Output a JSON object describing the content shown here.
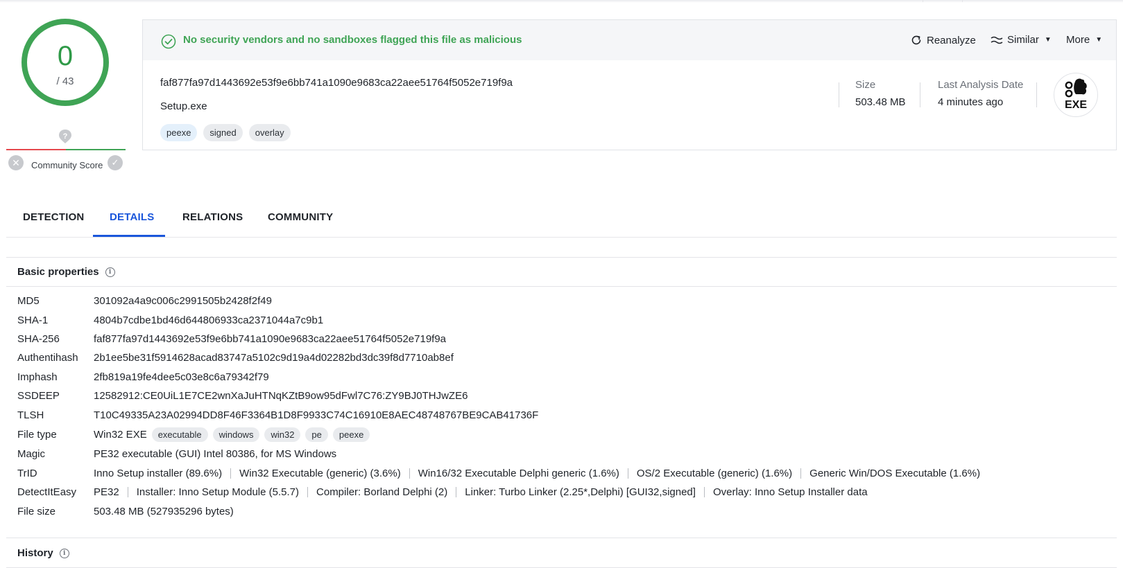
{
  "score": {
    "detections": "0",
    "total": "/ 43",
    "community_label": "Community Score"
  },
  "banner": {
    "message": "No security vendors and no sandboxes flagged this file as malicious"
  },
  "actions": {
    "reanalyze": "Reanalyze",
    "similar": "Similar",
    "more": "More"
  },
  "file": {
    "hash": "faf877fa97d1443692e53f9e6bb741a1090e9683ca22aee51764f5052e719f9a",
    "name": "Setup.exe",
    "tags": [
      "peexe",
      "signed",
      "overlay"
    ],
    "size_label": "Size",
    "size_value": "503.48 MB",
    "last_analysis_label": "Last Analysis Date",
    "last_analysis_value": "4 minutes ago",
    "type_badge": "EXE"
  },
  "tabs": [
    "DETECTION",
    "DETAILS",
    "RELATIONS",
    "COMMUNITY"
  ],
  "active_tab": "DETAILS",
  "basic_properties": {
    "title": "Basic properties",
    "rows": [
      {
        "key": "MD5",
        "value": "301092a4a9c006c2991505b2428f2f49"
      },
      {
        "key": "SHA-1",
        "value": "4804b7cdbe1bd46d644806933ca2371044a7c9b1"
      },
      {
        "key": "SHA-256",
        "value": "faf877fa97d1443692e53f9e6bb741a1090e9683ca22aee51764f5052e719f9a"
      },
      {
        "key": "Authentihash",
        "value": "2b1ee5be31f5914628acad83747a5102c9d19a4d02282bd3dc39f8d7710ab8ef"
      },
      {
        "key": "Imphash",
        "value": "2fb819a19fe4dee5c03e8c6a79342f79"
      },
      {
        "key": "SSDEEP",
        "value": "12582912:CE0UiL1E7CE2wnXaJuHTNqKZtB9ow95dFwl7C76:ZY9BJ0THJwZE6"
      },
      {
        "key": "TLSH",
        "value": "T10C49335A23A02994DD8F46F3364B1D8F9933C74C16910E8AEC48748767BE9CAB41736F"
      },
      {
        "key": "File type",
        "value": "Win32 EXE",
        "chips": [
          "executable",
          "windows",
          "win32",
          "pe",
          "peexe"
        ]
      },
      {
        "key": "Magic",
        "value": "PE32 executable (GUI) Intel 80386, for MS Windows"
      },
      {
        "key": "TrID",
        "segments": [
          "Inno Setup installer (89.6%)",
          "Win32 Executable (generic) (3.6%)",
          "Win16/32 Executable Delphi generic (1.6%)",
          "OS/2 Executable (generic) (1.6%)",
          "Generic Win/DOS Executable (1.6%)"
        ]
      },
      {
        "key": "DetectItEasy",
        "segments": [
          "PE32",
          "Installer: Inno Setup Module (5.5.7)",
          "Compiler: Borland Delphi (2)",
          "Linker: Turbo Linker (2.25*,Delphi) [GUI32,signed]",
          "Overlay: Inno Setup Installer data"
        ]
      },
      {
        "key": "File size",
        "value": "503.48 MB (527935296 bytes)"
      }
    ]
  },
  "history": {
    "title": "History"
  },
  "colors": {
    "clean": "#3fa455",
    "accent": "#1a56db",
    "malicious": "#e5484d"
  }
}
